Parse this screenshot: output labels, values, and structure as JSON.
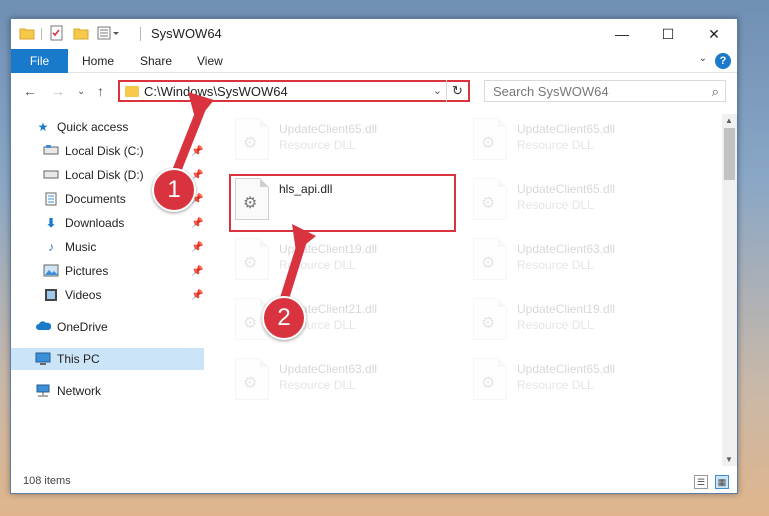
{
  "window": {
    "title": "SysWOW64",
    "controls": {
      "minimize": "—",
      "maximize": "☐",
      "close": "✕"
    }
  },
  "quick_access_toolbar": [
    "folder-icon",
    "properties-icon",
    "new-folder-icon",
    "customize-icon"
  ],
  "ribbon": {
    "file": "File",
    "tabs": [
      "Home",
      "Share",
      "View"
    ],
    "help": "?"
  },
  "navigation": {
    "address": "C:\\Windows\\SysWOW64",
    "search_placeholder": "Search SysWOW64"
  },
  "sidebar": {
    "items": [
      {
        "label": "Quick access",
        "icon": "star-icon",
        "pinned": false
      },
      {
        "label": "Local Disk (C:)",
        "icon": "drive-icon",
        "pinned": true
      },
      {
        "label": "Local Disk (D:)",
        "icon": "drive-icon",
        "pinned": true
      },
      {
        "label": "Documents",
        "icon": "documents-icon",
        "pinned": true
      },
      {
        "label": "Downloads",
        "icon": "download-icon",
        "pinned": true
      },
      {
        "label": "Music",
        "icon": "music-icon",
        "pinned": true
      },
      {
        "label": "Pictures",
        "icon": "pictures-icon",
        "pinned": true
      },
      {
        "label": "Videos",
        "icon": "videos-icon",
        "pinned": true
      },
      {
        "label": "OneDrive",
        "icon": "cloud-icon",
        "pinned": false
      },
      {
        "label": "This PC",
        "icon": "computer-icon",
        "pinned": false,
        "selected": true
      },
      {
        "label": "Network",
        "icon": "network-icon",
        "pinned": false
      }
    ]
  },
  "files": {
    "left_column": [
      {
        "name": "UpdateClient65.dll",
        "desc": "Resource DLL",
        "faded": true
      },
      {
        "name": "hls_api.dll",
        "desc": "",
        "faded": false,
        "highlighted": true
      },
      {
        "name": "UpdateClient19.dll",
        "desc": "Resource DLL",
        "faded": true
      },
      {
        "name": "UpdateClient21.dll",
        "desc": "Resource DLL",
        "faded": true
      },
      {
        "name": "UpdateClient63.dll",
        "desc": "Resource DLL",
        "faded": true
      }
    ],
    "right_column": [
      {
        "name": "UpdateClient65.dll",
        "desc": "Resource DLL",
        "faded": true
      },
      {
        "name": "UpdateClient65.dll",
        "desc": "Resource DLL",
        "faded": true
      },
      {
        "name": "UpdateClient63.dll",
        "desc": "Resource DLL",
        "faded": true
      },
      {
        "name": "UpdateClient19.dll",
        "desc": "Resource DLL",
        "faded": true
      },
      {
        "name": "UpdateClient65.dll",
        "desc": "Resource DLL",
        "faded": true
      }
    ]
  },
  "status": {
    "item_count": "108 items"
  },
  "annotations": {
    "marker_1": "1",
    "marker_2": "2",
    "color": "#d9333f"
  },
  "colors": {
    "accent": "#1979ca",
    "selection": "#cce4f7",
    "annotation": "#d9333f"
  }
}
